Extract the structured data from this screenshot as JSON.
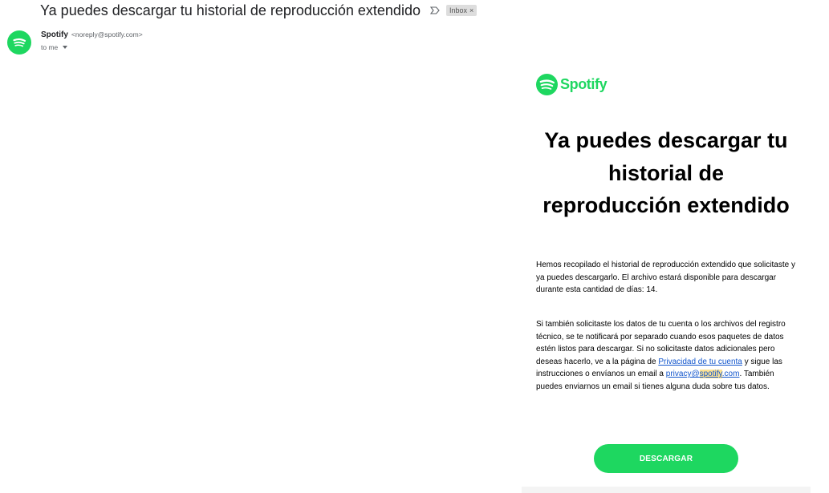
{
  "email": {
    "subject": "Ya puedes descargar tu historial de reproducción extendido",
    "label_chip": "Inbox",
    "label_chip_close": "×",
    "sender_name": "Spotify",
    "sender_email": "<noreply@spotify.com>",
    "to_line": "to me"
  },
  "body": {
    "logo_text": "Spotify",
    "headline": "Ya puedes descargar tu historial de reproducción extendido",
    "paragraph1": "Hemos recopilado el historial de reproducción extendido que solicitaste y ya puedes descargarlo. El archivo estará disponible para descargar durante esta cantidad de días: 14.",
    "paragraph2_a": "Si también solicitaste los datos de tu cuenta o los archivos del registro técnico, se te notificará por separado cuando esos paquetes de datos estén listos para descargar. Si no solicitaste datos adicionales pero deseas hacerlo, ve a la página de ",
    "privacy_link": "Privacidad de tu cuenta",
    "paragraph2_b": " y sigue las instrucciones o envíanos un email a ",
    "email_link_prefix": "privacy@",
    "email_link_highlight": "spotify",
    "email_link_suffix": ".com",
    "paragraph2_c": ". También puedes enviarnos un email si tienes alguna duda sobre tus datos.",
    "cta_label": "DESCARGAR"
  },
  "colors": {
    "spotify_green": "#1ed760",
    "link_blue": "#1155cc",
    "highlight": "#fde293"
  },
  "icons": {
    "important": "important-marker-icon",
    "spotify": "spotify-logo-icon",
    "caret": "chevron-down-icon"
  }
}
